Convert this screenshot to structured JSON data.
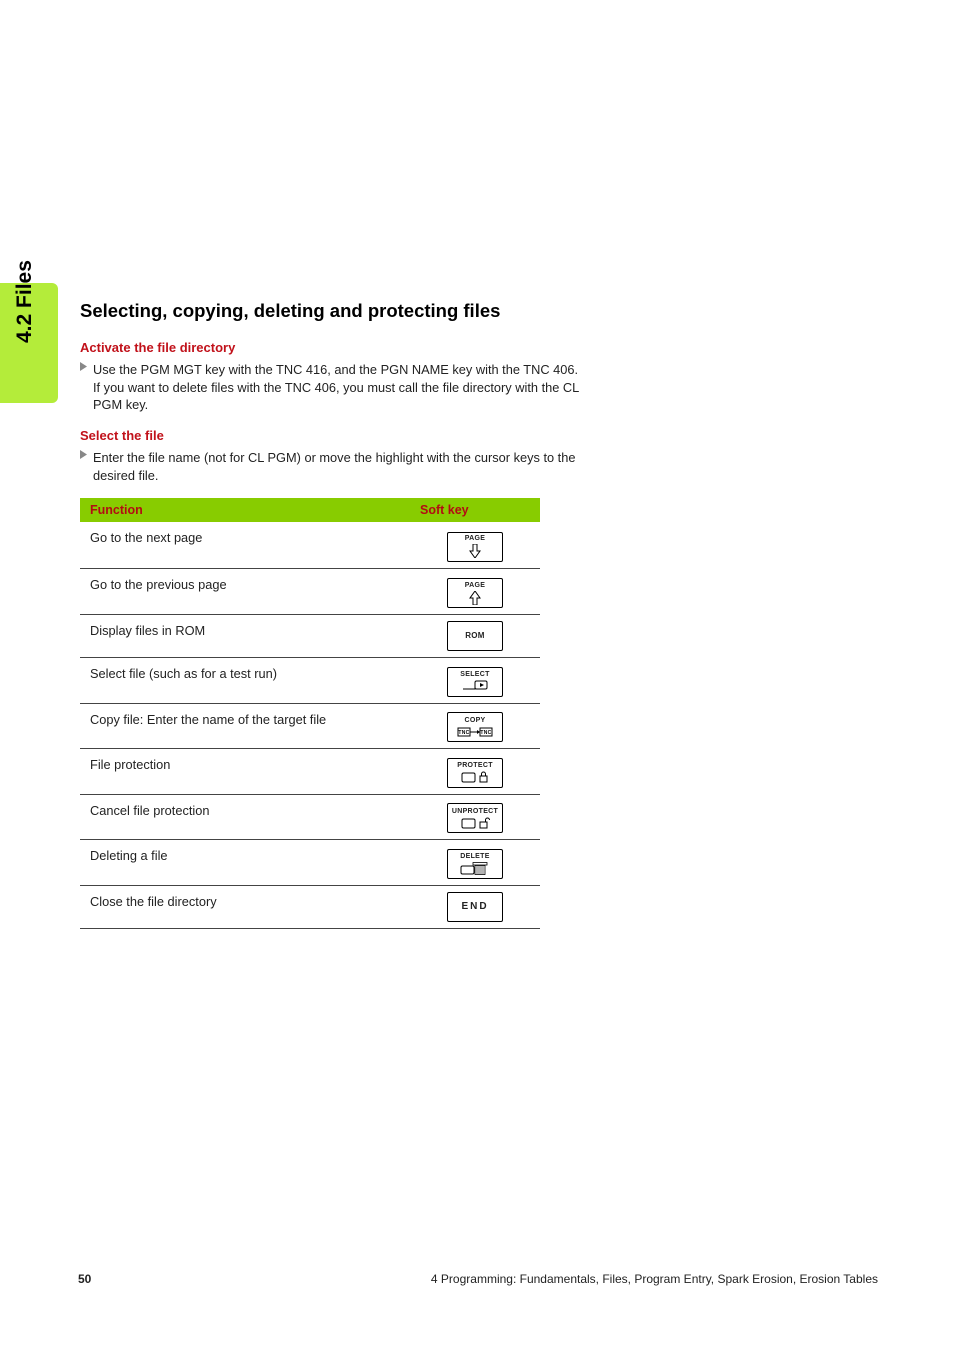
{
  "sideTab": "4.2 Files",
  "title": "Selecting, copying, deleting and protecting files",
  "blocks": [
    {
      "heading": "Activate the file directory",
      "text": "Use the PGM MGT key with the TNC 416, and the PGN NAME key with the TNC 406. If you want to delete files with the TNC 406, you must call the file directory with the CL PGM key."
    },
    {
      "heading": "Select the file",
      "text": "Enter the file name (not for CL PGM) or move the highlight with the cursor keys to the desired file."
    }
  ],
  "table": {
    "headers": {
      "function": "Function",
      "softkey": "Soft key"
    },
    "rows": [
      {
        "fn": "Go to the next page",
        "sk_label": "PAGE",
        "sk_icon": "arrow-down"
      },
      {
        "fn": "Go to the previous page",
        "sk_label": "PAGE",
        "sk_icon": "arrow-up"
      },
      {
        "fn": "Display files in ROM",
        "sk_label": "ROM",
        "sk_icon": "none"
      },
      {
        "fn": "Select file (such as for a test run)",
        "sk_label": "SELECT",
        "sk_icon": "select"
      },
      {
        "fn": "Copy file: Enter the name of the target file",
        "sk_label": "COPY",
        "sk_icon": "copy"
      },
      {
        "fn": "File protection",
        "sk_label": "PROTECT",
        "sk_icon": "protect"
      },
      {
        "fn": "Cancel file protection",
        "sk_label": "UNPROTECT",
        "sk_icon": "unprotect"
      },
      {
        "fn": "Deleting a file",
        "sk_label": "DELETE",
        "sk_icon": "delete"
      },
      {
        "fn": "Close the file directory",
        "sk_label": "END",
        "sk_icon": "end"
      }
    ]
  },
  "footer": {
    "page": "50",
    "chapter": "4 Programming: Fundamentals, Files, Program Entry, Spark Erosion, Erosion Tables"
  }
}
